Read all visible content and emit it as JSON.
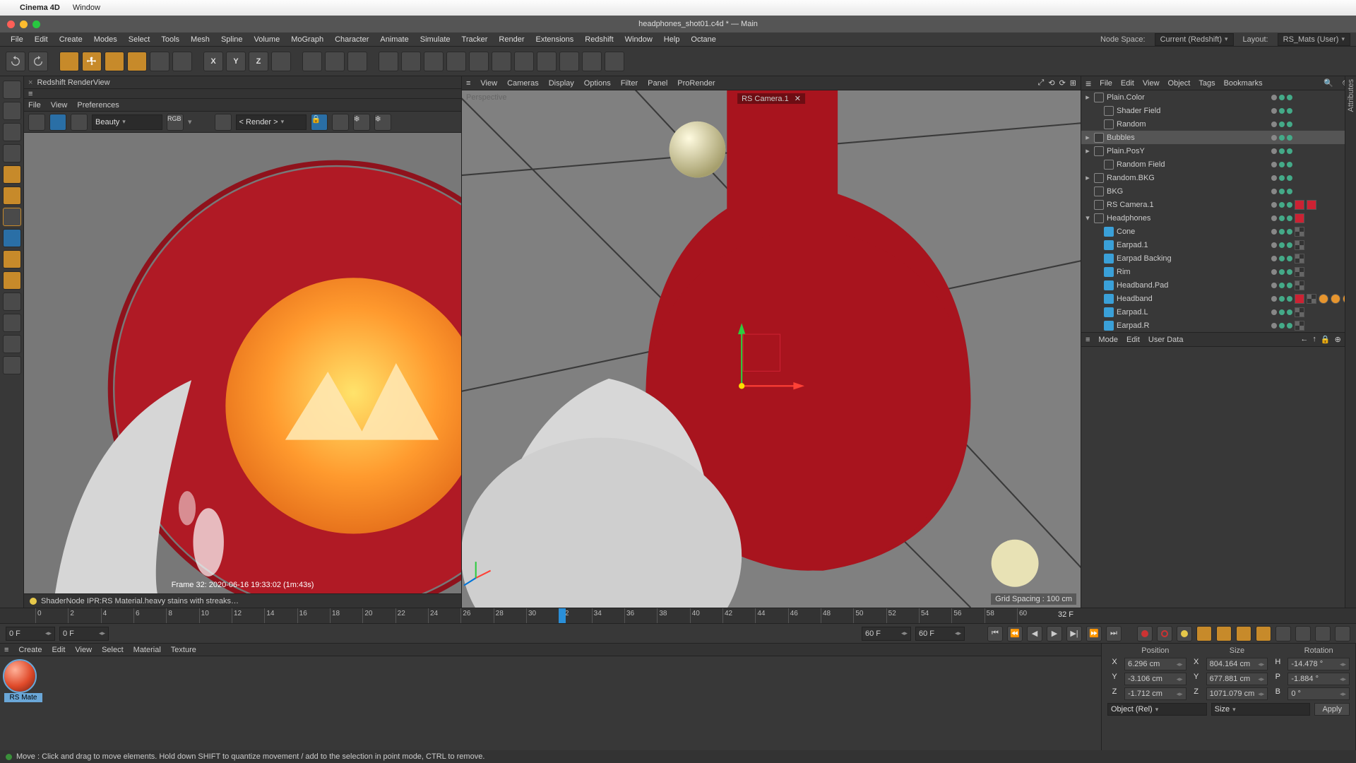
{
  "mac_menu": {
    "apple": "",
    "app": "Cinema 4D",
    "items": [
      "Window"
    ]
  },
  "doc_title": "headphones_shot01.c4d * — Main",
  "main_menu": {
    "items": [
      "File",
      "Edit",
      "Create",
      "Modes",
      "Select",
      "Tools",
      "Mesh",
      "Spline",
      "Volume",
      "MoGraph",
      "Character",
      "Animate",
      "Simulate",
      "Tracker",
      "Render",
      "Extensions",
      "Redshift",
      "Window",
      "Help",
      "Octane"
    ],
    "node_space_label": "Node Space:",
    "node_space_value": "Current (Redshift)",
    "layout_label": "Layout:",
    "layout_value": "RS_Mats (User)"
  },
  "renderview": {
    "tab_title": "Redshift RenderView",
    "menu": [
      "File",
      "View",
      "Preferences"
    ],
    "pass": "Beauty",
    "colorspace": "RGB",
    "render_label": "< Render >",
    "caption": "Frame  32:  2020-06-16  19:33:02  (1m:43s)",
    "status": "ShaderNode IPR:RS Material.heavy stains with streaks…"
  },
  "viewport": {
    "menu": [
      "View",
      "Cameras",
      "Display",
      "Options",
      "Filter",
      "Panel",
      "ProRender"
    ],
    "projection": "Perspective",
    "camera": "RS Camera.1",
    "grid_spacing": "Grid Spacing : 100 cm"
  },
  "object_manager": {
    "menu": [
      "File",
      "Edit",
      "View",
      "Object",
      "Tags",
      "Bookmarks"
    ],
    "tree": [
      {
        "name": "Plain.Color",
        "indent": 0,
        "expand": "▸",
        "icon": "null"
      },
      {
        "name": "Shader Field",
        "indent": 1,
        "expand": "",
        "icon": "null"
      },
      {
        "name": "Random",
        "indent": 1,
        "expand": "",
        "icon": "null"
      },
      {
        "name": "Bubbles",
        "indent": 0,
        "expand": "▸",
        "icon": "null",
        "selected": true
      },
      {
        "name": "Plain.PosY",
        "indent": 0,
        "expand": "▸",
        "icon": "null"
      },
      {
        "name": "Random Field",
        "indent": 1,
        "expand": "",
        "icon": "null"
      },
      {
        "name": "Random.BKG",
        "indent": 0,
        "expand": "▸",
        "icon": "null"
      },
      {
        "name": "BKG",
        "indent": 0,
        "expand": "",
        "icon": "null"
      },
      {
        "name": "RS Camera.1",
        "indent": 0,
        "expand": "",
        "icon": "cam",
        "tags": [
          "red",
          "red"
        ]
      },
      {
        "name": "Headphones",
        "indent": 0,
        "expand": "▾",
        "icon": "null",
        "tags": [
          "red"
        ]
      },
      {
        "name": "Cone",
        "indent": 1,
        "expand": "",
        "icon": "poly",
        "tags": [
          "chk"
        ]
      },
      {
        "name": "Earpad.1",
        "indent": 1,
        "expand": "",
        "icon": "poly",
        "tags": [
          "chk"
        ]
      },
      {
        "name": "Earpad Backing",
        "indent": 1,
        "expand": "",
        "icon": "poly",
        "tags": [
          "chk"
        ]
      },
      {
        "name": "Rim",
        "indent": 1,
        "expand": "",
        "icon": "poly",
        "tags": [
          "chk"
        ]
      },
      {
        "name": "Headband.Pad",
        "indent": 1,
        "expand": "",
        "icon": "poly",
        "tags": [
          "chk"
        ]
      },
      {
        "name": "Headband",
        "indent": 1,
        "expand": "",
        "icon": "poly",
        "tags": [
          "red",
          "chk",
          "orng",
          "orng",
          "orng"
        ]
      },
      {
        "name": "Earpad.L",
        "indent": 1,
        "expand": "",
        "icon": "poly",
        "tags": [
          "chk"
        ]
      },
      {
        "name": "Earpad.R",
        "indent": 1,
        "expand": "",
        "icon": "poly",
        "tags": [
          "chk"
        ]
      }
    ]
  },
  "attr": {
    "menu": [
      "Mode",
      "Edit",
      "User Data"
    ]
  },
  "timeline": {
    "start": 0,
    "end": 60,
    "current": "32 F",
    "range_start": "0 F",
    "range_start2": "0 F",
    "range_end": "60 F",
    "range_end2": "60 F",
    "ticks": [
      0,
      2,
      4,
      6,
      8,
      10,
      12,
      14,
      16,
      18,
      20,
      22,
      24,
      26,
      28,
      30,
      32,
      34,
      36,
      38,
      40,
      42,
      44,
      46,
      48,
      50,
      52,
      54,
      56,
      58,
      60
    ]
  },
  "materials": {
    "menu": [
      "Create",
      "Edit",
      "View",
      "Select",
      "Material",
      "Texture"
    ],
    "items": [
      {
        "name": "RS Mate"
      }
    ]
  },
  "coord": {
    "headers": {
      "pos": "Position",
      "size": "Size",
      "rot": "Rotation"
    },
    "x": {
      "pos": "6.296 cm",
      "size": "804.164 cm",
      "rot": "-14.478 °"
    },
    "y": {
      "pos": "-3.106 cm",
      "size": "677.881 cm",
      "rot": "-1.884 °"
    },
    "z": {
      "pos": "-1.712 cm",
      "size": "1071.079 cm",
      "rot": "0 °"
    },
    "axis": {
      "x": "X",
      "y": "Y",
      "z": "Z",
      "h": "H",
      "p": "P",
      "b": "B"
    },
    "mode_pos": "Object (Rel)",
    "mode_size": "Size",
    "apply": "Apply"
  },
  "statusbar": "Move : Click and drag to move elements. Hold down SHIFT to quantize movement / add to the selection in point mode, CTRL to remove.",
  "right_edge": {
    "tab": "Attributes"
  }
}
